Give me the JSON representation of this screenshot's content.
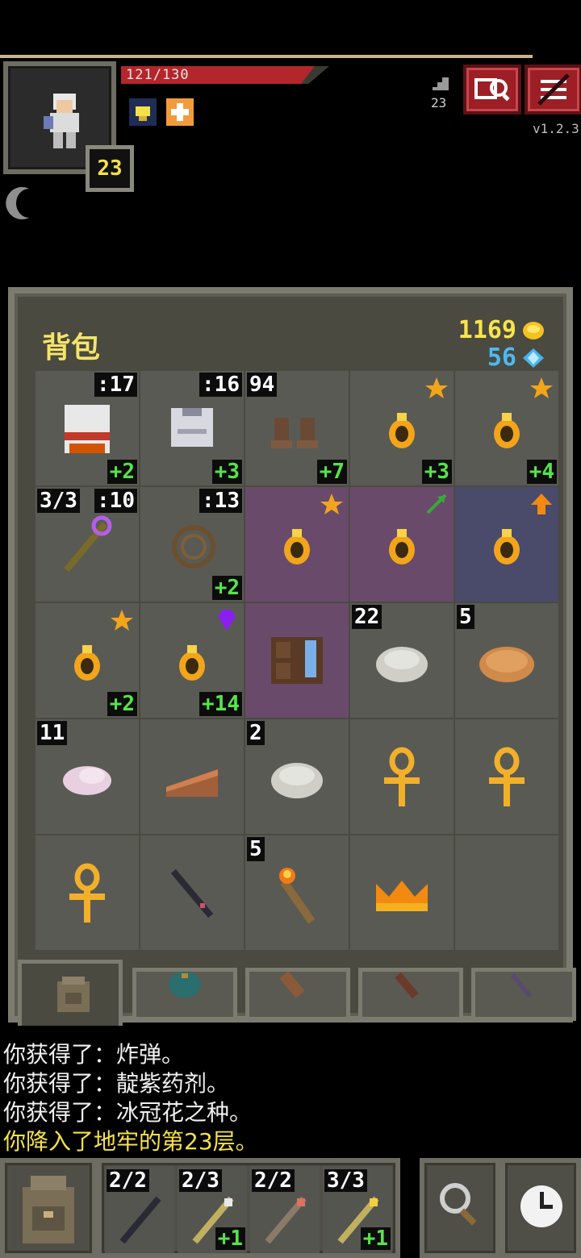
{
  "status": {
    "hp_text": "121/130",
    "hp_fraction": 0.93,
    "level": "23",
    "depth": "23",
    "version": "v1.2.3"
  },
  "bag": {
    "title": "背包",
    "gold": "1169",
    "gems": "56",
    "slots": [
      {
        "item": "gauntlets",
        "tl": "",
        "tr": ":17",
        "br": "+2"
      },
      {
        "item": "plate-armor",
        "tl": "",
        "tr": ":16",
        "br": "+3"
      },
      {
        "item": "boots",
        "tl": "94",
        "tr": "",
        "br": "+7"
      },
      {
        "item": "ring",
        "tl": "",
        "tr": "",
        "br": "+3"
      },
      {
        "item": "ring",
        "tl": "",
        "tr": "",
        "br": "+4"
      },
      {
        "item": "magic-staff",
        "tl": "3/3",
        "tr": ":10",
        "br": ""
      },
      {
        "item": "whip",
        "tl": "",
        "tr": ":13",
        "br": "+2"
      },
      {
        "item": "ring",
        "tl": "",
        "tr": "",
        "br": ""
      },
      {
        "item": "ring",
        "tl": "",
        "tr": "",
        "br": ""
      },
      {
        "item": "ring",
        "tl": "",
        "tr": "",
        "br": ""
      },
      {
        "item": "ring",
        "tl": "",
        "tr": "",
        "br": "+2"
      },
      {
        "item": "ring",
        "tl": "",
        "tr": "",
        "br": "+14"
      },
      {
        "item": "alchemy-book",
        "tl": "",
        "tr": "",
        "br": ""
      },
      {
        "item": "stone",
        "tl": "22",
        "tr": "",
        "br": ""
      },
      {
        "item": "pancake",
        "tl": "5",
        "tr": "",
        "br": ""
      },
      {
        "item": "raw-meat",
        "tl": "11",
        "tr": "",
        "br": ""
      },
      {
        "item": "pie-slice",
        "tl": "",
        "tr": "",
        "br": ""
      },
      {
        "item": "stone",
        "tl": "2",
        "tr": "",
        "br": ""
      },
      {
        "item": "ankh",
        "tl": "",
        "tr": "",
        "br": ""
      },
      {
        "item": "ankh",
        "tl": "",
        "tr": "",
        "br": ""
      },
      {
        "item": "ankh",
        "tl": "",
        "tr": "",
        "br": ""
      },
      {
        "item": "dark-wand",
        "tl": "",
        "tr": "",
        "br": ""
      },
      {
        "item": "torch",
        "tl": "5",
        "tr": "",
        "br": ""
      },
      {
        "item": "crown",
        "tl": "",
        "tr": "",
        "br": ""
      },
      {
        "item": "empty",
        "tl": "",
        "tr": "",
        "br": ""
      }
    ]
  },
  "log": [
    {
      "text": "你获得了：炸弹。",
      "highlight": false
    },
    {
      "text": "你获得了：靛紫药剂。",
      "highlight": false
    },
    {
      "text": "你获得了：冰冠花之种。",
      "highlight": false
    },
    {
      "text": "你降入了地牢的第23层。",
      "highlight": true
    }
  ],
  "quickslots": [
    {
      "count": "2/2",
      "plus": ""
    },
    {
      "count": "2/3",
      "plus": "+1"
    },
    {
      "count": "2/2",
      "plus": ""
    },
    {
      "count": "3/3",
      "plus": "+1"
    }
  ],
  "colors": {
    "gold": "#f7e44f",
    "gem": "#4fb8f0",
    "upgrade": "#57e34d",
    "hp": "#b3262b",
    "highlight_log": "#f5e24c"
  }
}
